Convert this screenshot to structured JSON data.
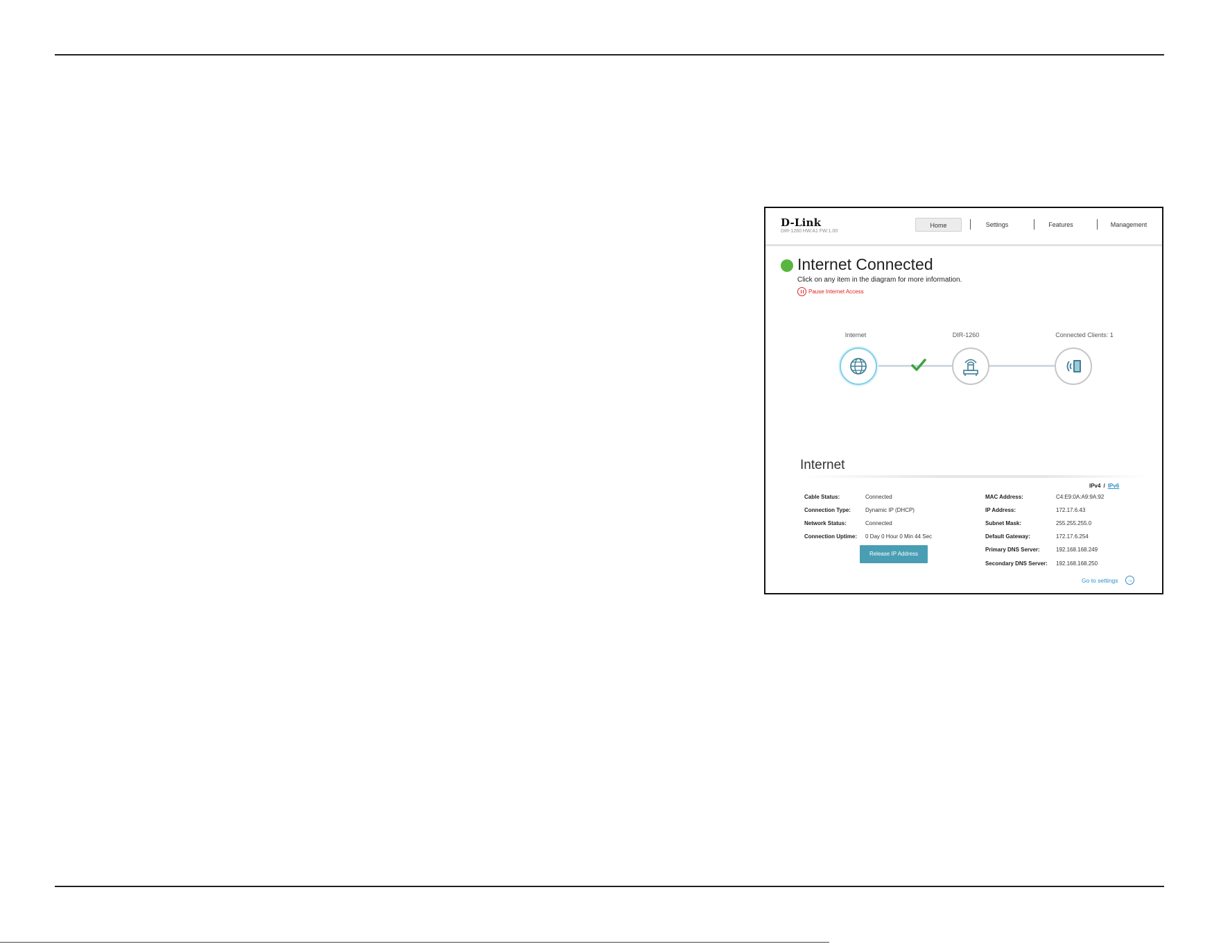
{
  "router_ui": {
    "brand": "D-Link",
    "model_info": "DIR-1260 HW:A1 FW:1.00",
    "nav": {
      "home": "Home",
      "settings": "Settings",
      "features": "Features",
      "management": "Management"
    },
    "status": {
      "title": "Internet Connected",
      "subtitle": "Click on any item in the diagram for more information.",
      "pause_link": "Pause Internet Access",
      "indicator_color": "#58b540"
    },
    "diagram": {
      "internet_label": "Internet",
      "router_label": "DIR-1260",
      "clients_label": "Connected Clients: 1",
      "connection_ok": true
    },
    "section": {
      "title": "Internet",
      "ipv4": "IPv4",
      "separator": "/",
      "ipv6": "IPv6"
    },
    "left_fields": [
      {
        "label": "Cable Status:",
        "value": "Connected"
      },
      {
        "label": "Connection Type:",
        "value": "Dynamic IP (DHCP)"
      },
      {
        "label": "Network Status:",
        "value": "Connected"
      },
      {
        "label": "Connection Uptime:",
        "value": "0 Day 0 Hour 0 Min 44 Sec"
      }
    ],
    "right_fields": [
      {
        "label": "MAC Address:",
        "value": "C4:E9:0A:A9:9A:92"
      },
      {
        "label": "IP Address:",
        "value": "172.17.6.43"
      },
      {
        "label": "Subnet Mask:",
        "value": "255.255.255.0"
      },
      {
        "label": "Default Gateway:",
        "value": "172.17.6.254"
      },
      {
        "label": "Primary DNS Server:",
        "value": "192.168.168.249"
      },
      {
        "label": "Secondary DNS Server:",
        "value": "192.168.168.250"
      }
    ],
    "release_button": "Release IP Address",
    "goto_settings": "Go to settings",
    "colors": {
      "accent": "#4a9eb4",
      "link": "#2d8fc6",
      "pause": "#e0211f"
    }
  }
}
